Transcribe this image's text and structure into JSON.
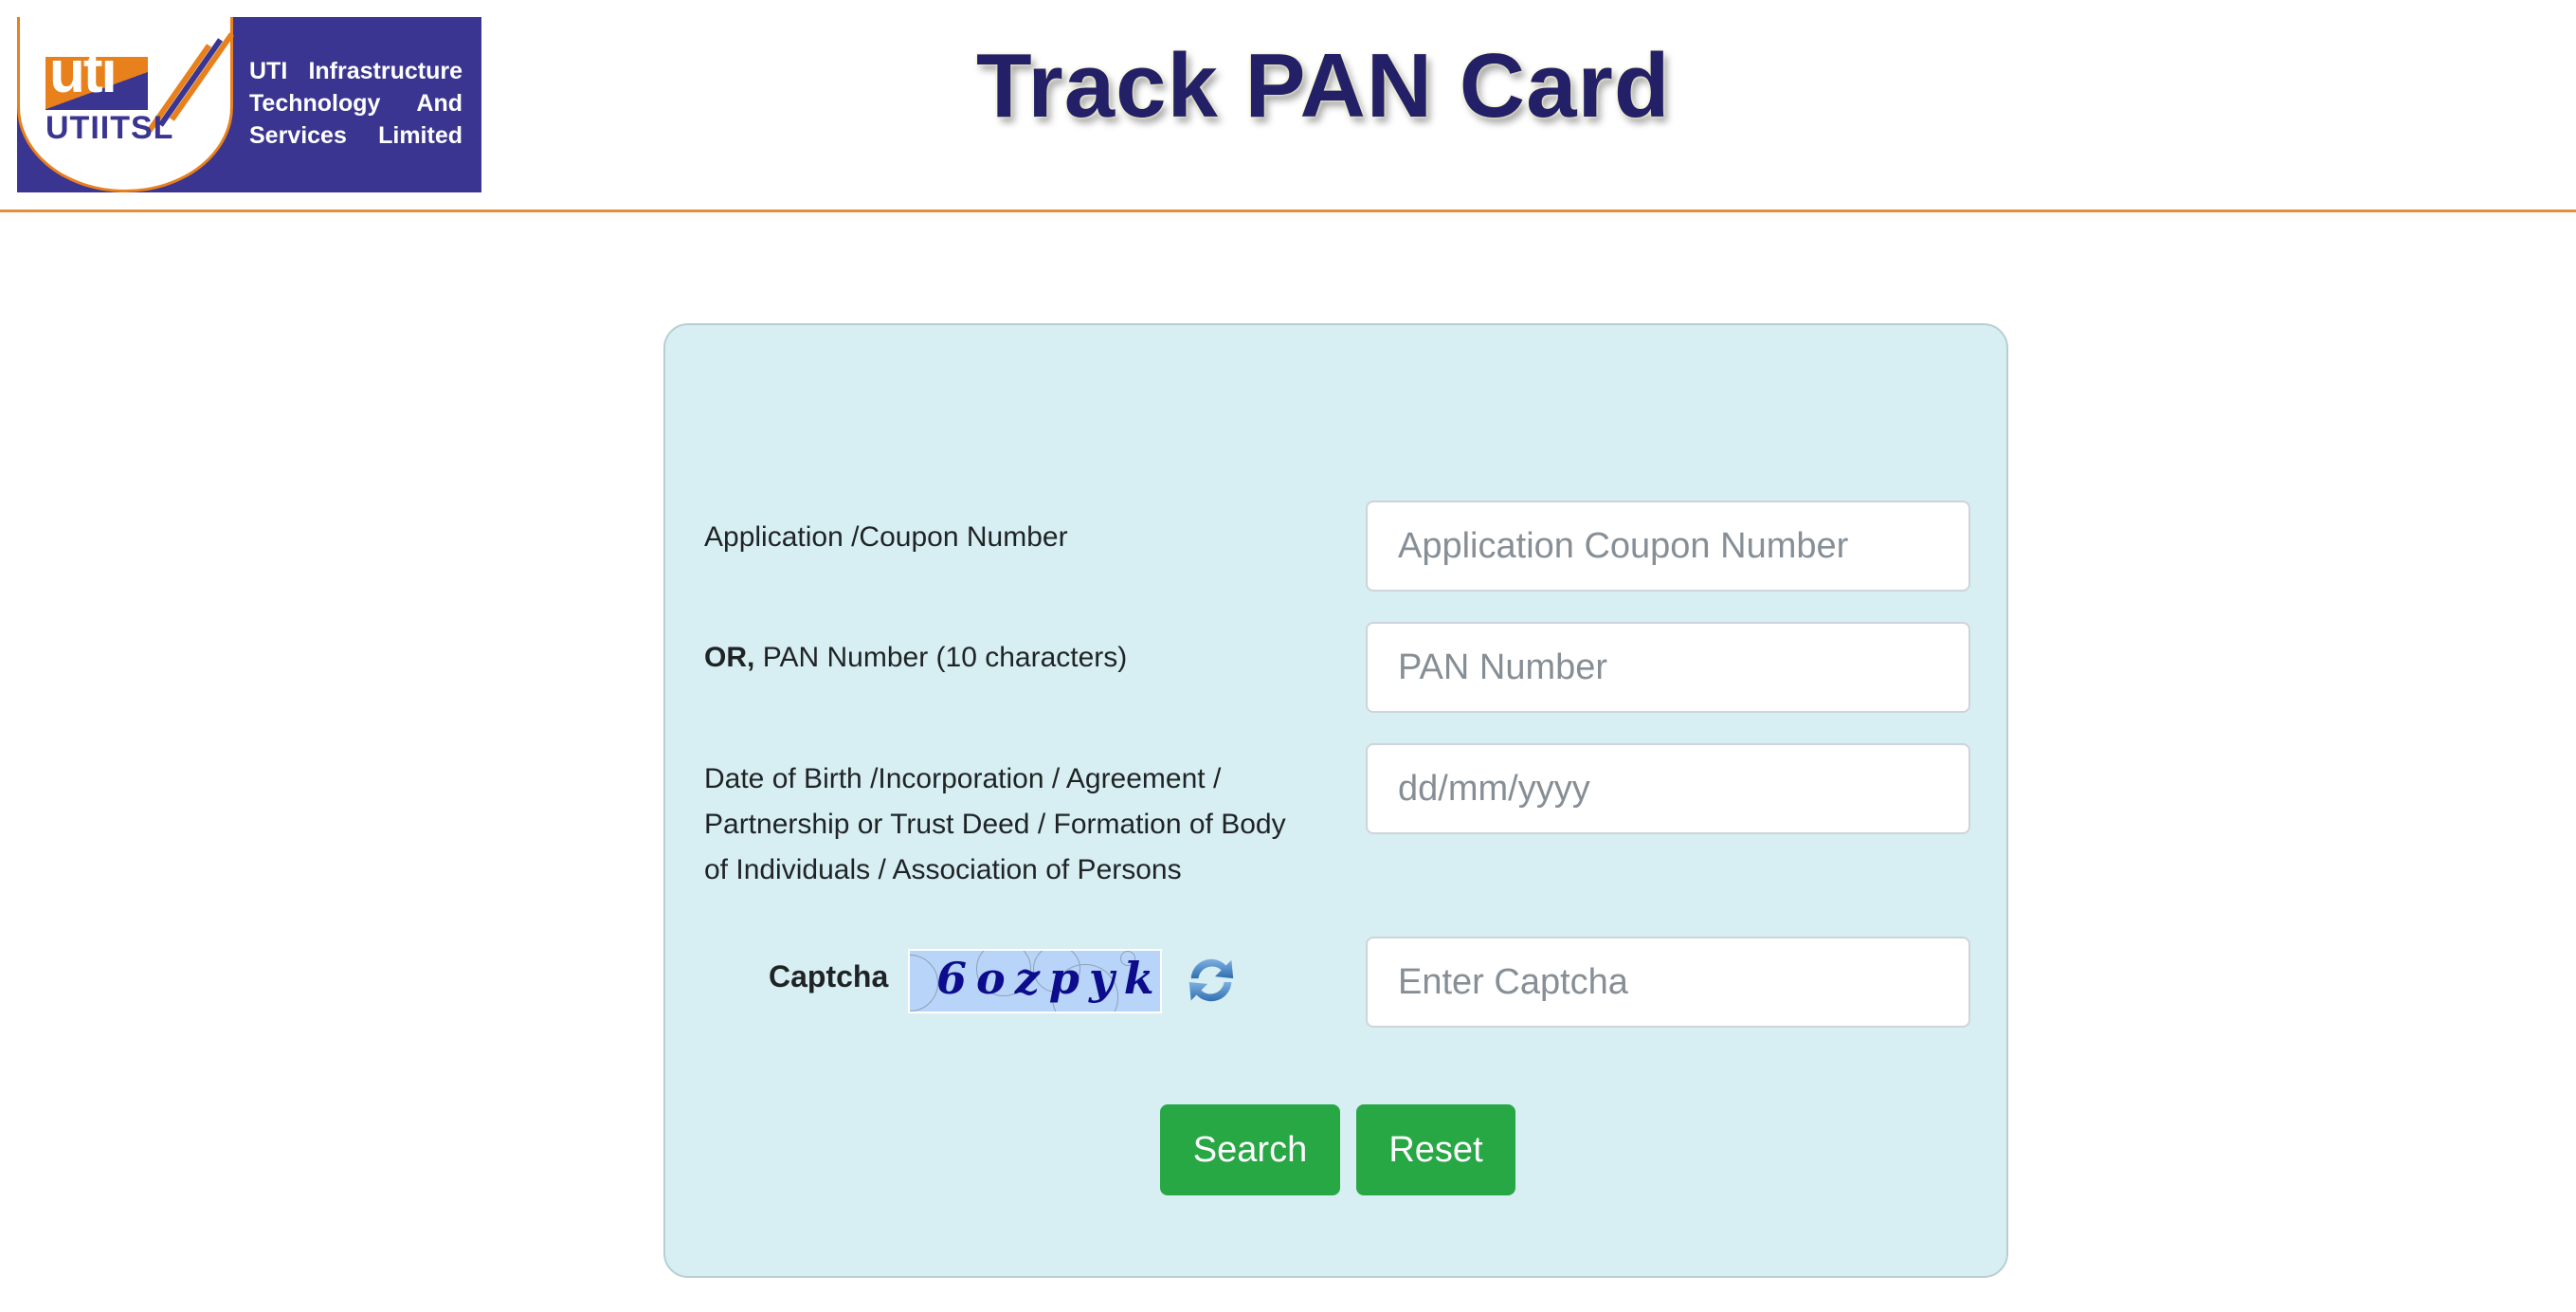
{
  "header": {
    "logo": {
      "mark_text": "uti",
      "short_name": "UTIITSL",
      "tagline_lines": [
        "UTI Infrastructure",
        "Technology And",
        "Services Limited"
      ],
      "colors": {
        "brand_navy": "#3a3590",
        "brand_orange": "#e8801c"
      }
    },
    "title": "Track PAN Card",
    "divider_color": "#e0913a"
  },
  "form": {
    "background_color": "#d7eff2",
    "application_number": {
      "label": "Application /Coupon Number",
      "placeholder": "Application Coupon Number",
      "value": ""
    },
    "pan_number": {
      "label_prefix": "OR,",
      "label": "PAN Number (10 characters)",
      "placeholder": "PAN Number",
      "value": ""
    },
    "date_of_birth": {
      "label": "Date of Birth /Incorporation / Agreement / Partnership or Trust Deed / Formation of Body of Individuals / Association of Persons",
      "placeholder": "dd/mm/yyyy",
      "value": ""
    },
    "captcha": {
      "label": "Captcha",
      "image_text": "6ozpyk",
      "refresh_icon": "refresh-icon",
      "placeholder": "Enter Captcha",
      "value": ""
    },
    "buttons": {
      "search_label": "Search",
      "reset_label": "Reset",
      "color": "#28a745"
    }
  }
}
